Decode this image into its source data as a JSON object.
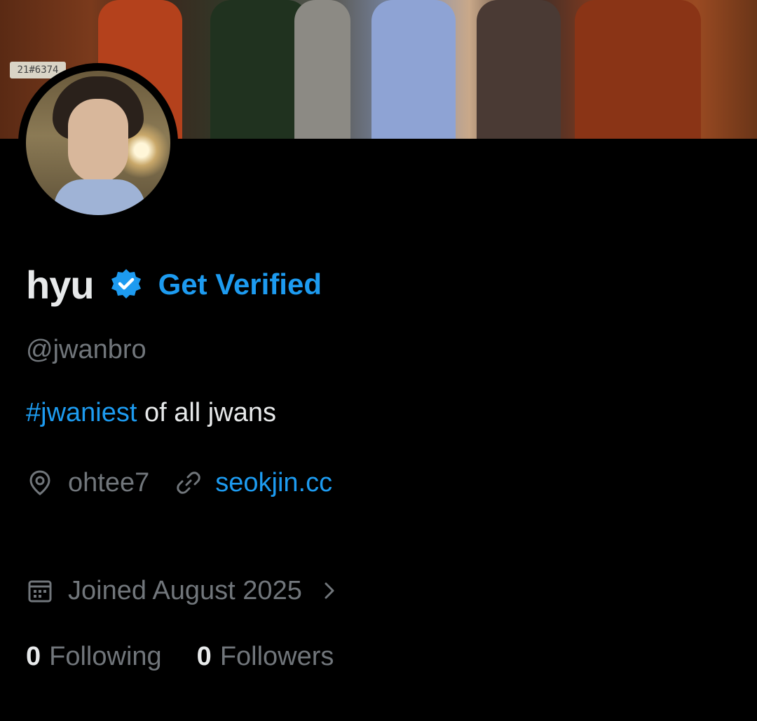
{
  "profile": {
    "display_name": "hyu",
    "get_verified_label": "Get Verified",
    "handle": "@jwanbro",
    "bio": {
      "hashtag": "#jwaniest",
      "text": " of all jwans"
    },
    "location": "ohtee7",
    "website": "seokjin.cc",
    "joined": "Joined August 2025",
    "following_count": "0",
    "following_label": "Following",
    "followers_count": "0",
    "followers_label": "Followers",
    "banner_plate_text": "21#6374"
  },
  "icons": {
    "verified": "verified-badge-icon",
    "location": "location-pin-icon",
    "link": "link-icon",
    "calendar": "calendar-icon",
    "chevron": "chevron-right-icon"
  },
  "colors": {
    "background": "#000000",
    "primary_text": "#e7e9ea",
    "secondary_text": "#71767b",
    "accent": "#1d9bf0"
  }
}
